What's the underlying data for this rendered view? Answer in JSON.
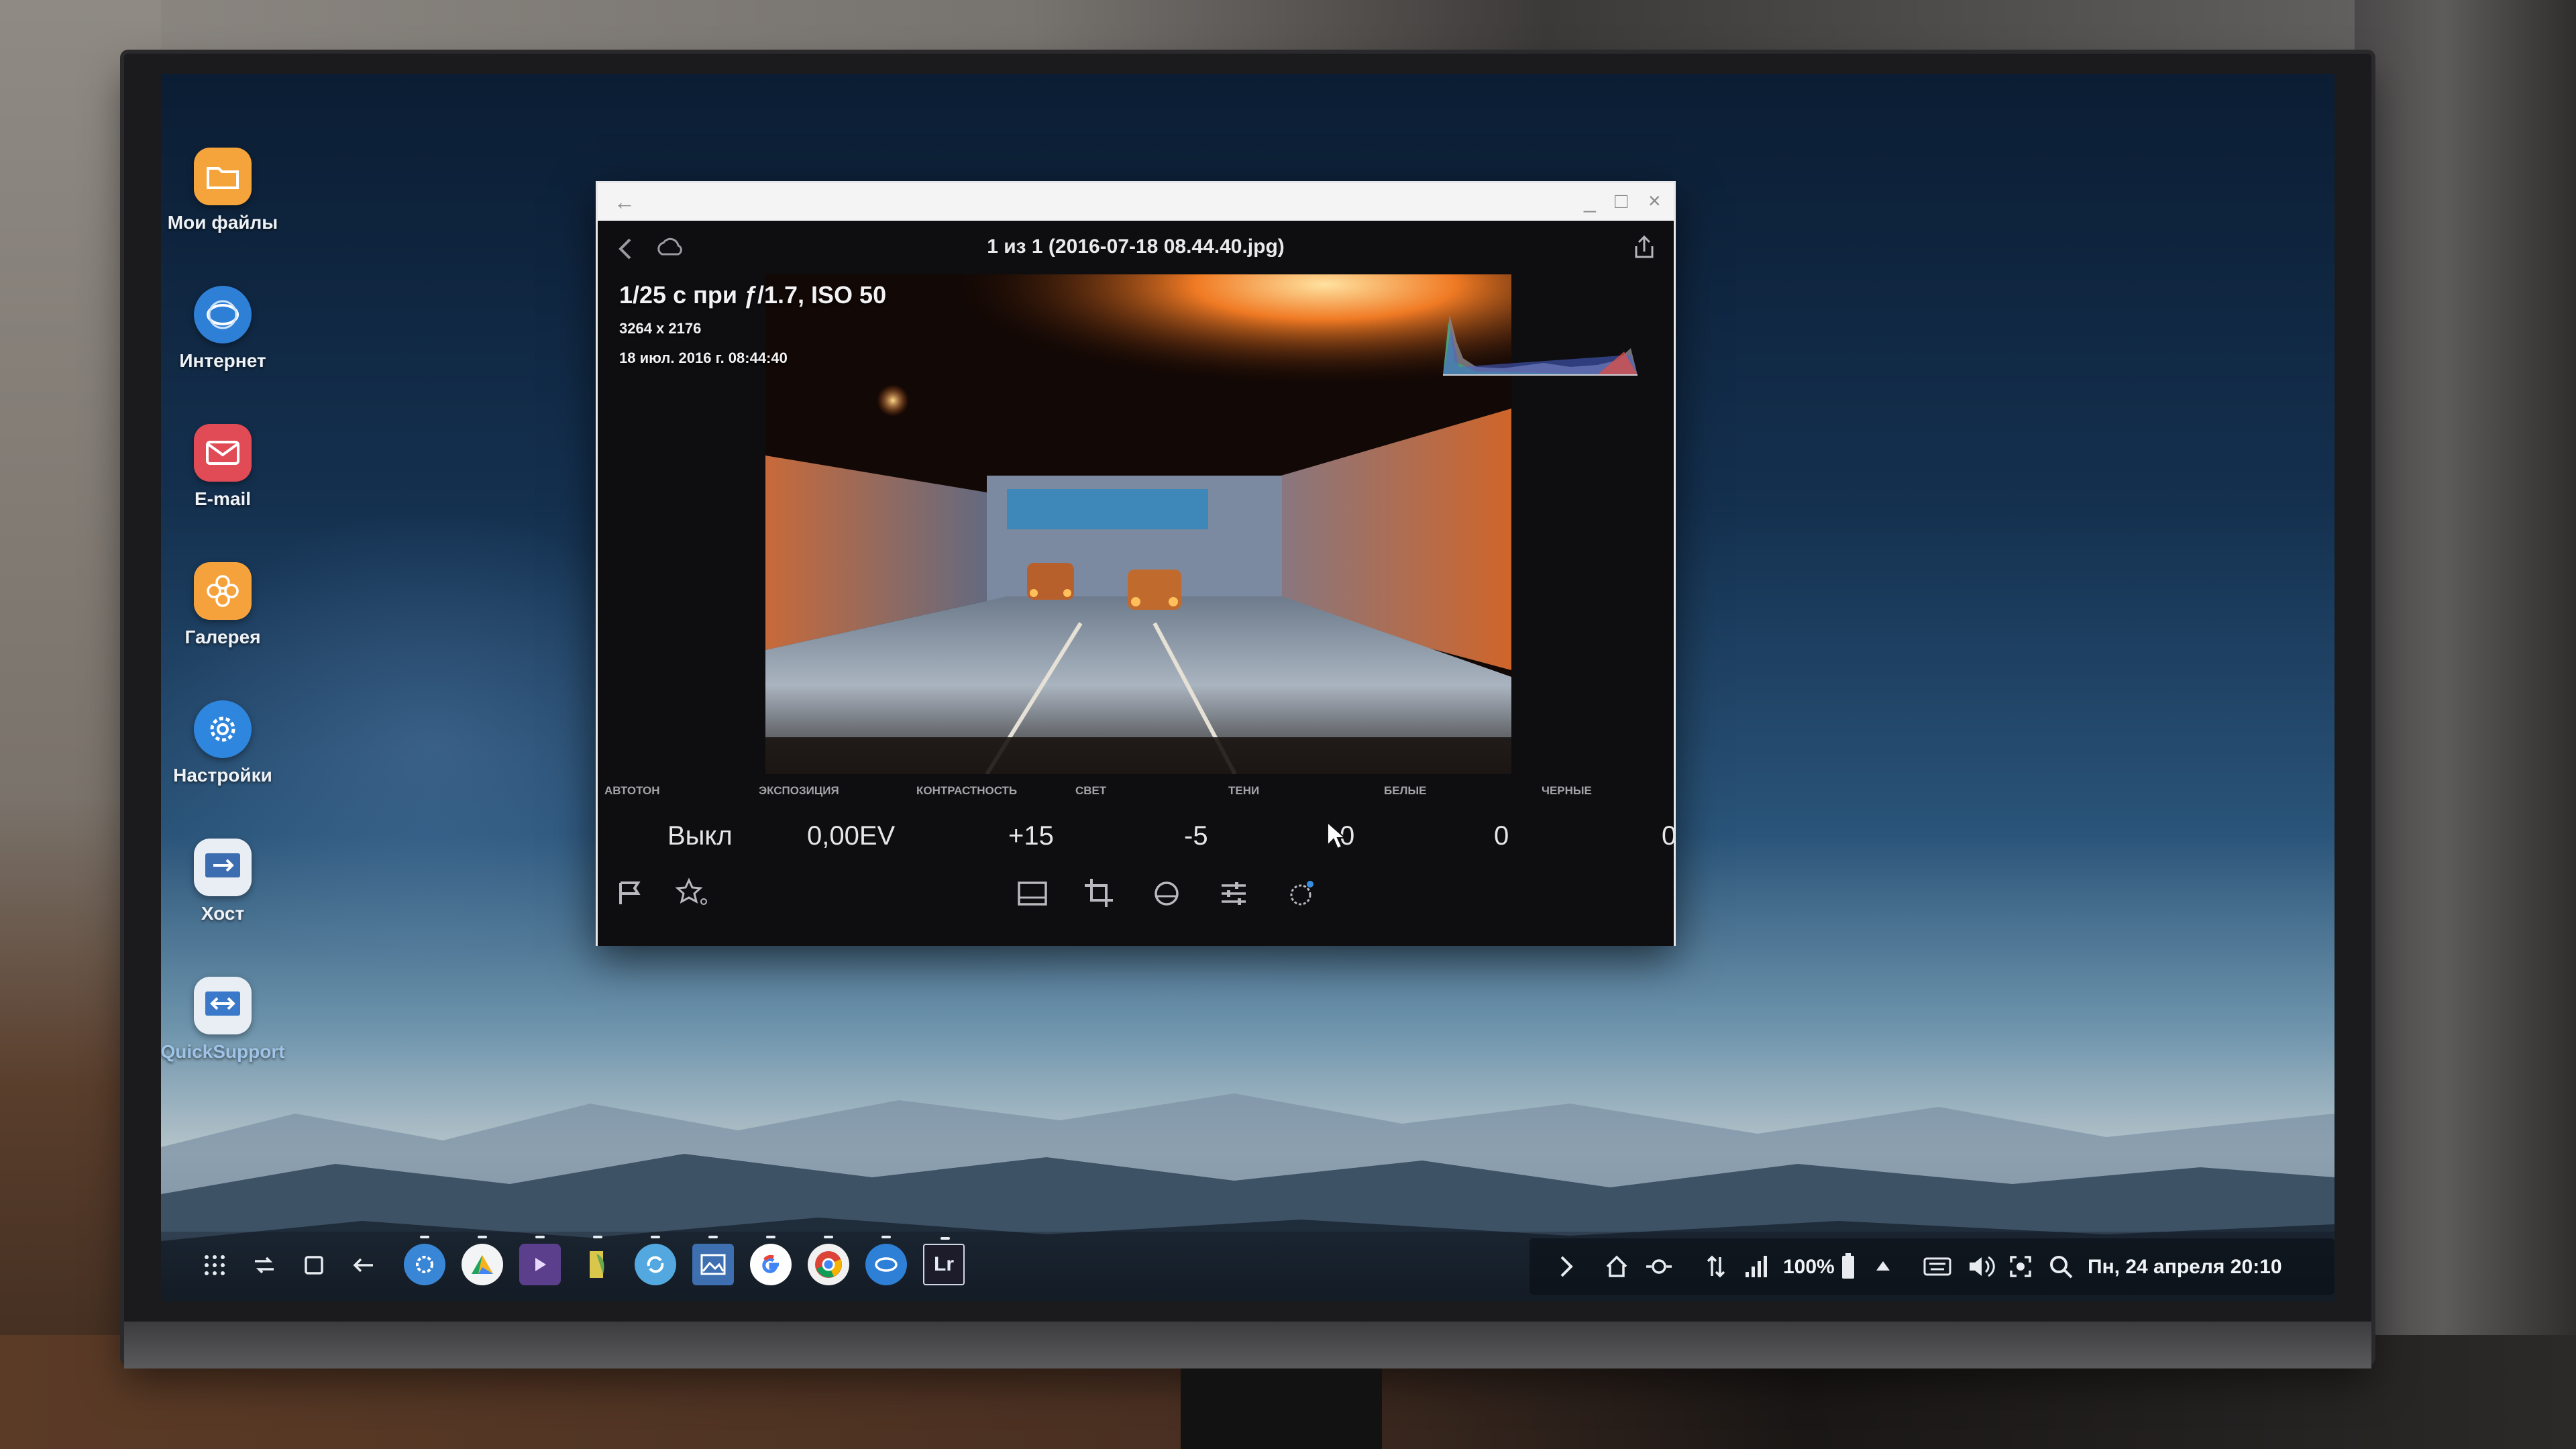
{
  "desktop": {
    "icons": [
      {
        "label": "Мои файлы",
        "icon": "folder-icon",
        "color": "#f4a43a"
      },
      {
        "label": "Интернет",
        "icon": "globe-icon",
        "color": "#2e7fd6"
      },
      {
        "label": "E-mail",
        "icon": "mail-icon",
        "color": "#e14b55"
      },
      {
        "label": "Галерея",
        "icon": "flower-icon",
        "color": "#f5a23c"
      },
      {
        "label": "Настройки",
        "icon": "gear-icon",
        "color": "#2f86de"
      },
      {
        "label": "Хост",
        "icon": "host-icon",
        "color": "#3b6db0"
      },
      {
        "label": "QuickSupport",
        "icon": "quicksupport-icon",
        "color": "#3a79c9"
      }
    ]
  },
  "window": {
    "back_glyph": "←",
    "minimize_glyph": "_",
    "maximize_glyph": "□",
    "close_glyph": "×",
    "title": "1 из 1 (2016-07-18 08.44.40.jpg)",
    "photo": {
      "exposure": "1/25 с при ƒ/1.7, ISO 50",
      "dimensions": "3264 x 2176",
      "date": "18 июл. 2016 г. 08:44:40"
    },
    "adjustments": [
      {
        "label": "Автотон",
        "value": "Выкл"
      },
      {
        "label": "Экспозиция",
        "value": "0,00EV"
      },
      {
        "label": "Контрастность",
        "value": "+15"
      },
      {
        "label": "Свет",
        "value": "-5"
      },
      {
        "label": "Тени",
        "value": "0"
      },
      {
        "label": "Белые",
        "value": "0"
      },
      {
        "label": "Черные",
        "value": "0"
      }
    ],
    "tools": [
      "flag-icon",
      "star-icon",
      "filmstrip-icon",
      "crop-icon",
      "filter-icon",
      "sliders-icon",
      "brush-icon"
    ]
  },
  "taskbar": {
    "system": [
      "apps-grid-icon",
      "recent-apps-icon",
      "home-icon",
      "back-arrow-icon"
    ],
    "apps": [
      {
        "name": "settings-app-icon",
        "color": "#3a86d6"
      },
      {
        "name": "drive-app-icon",
        "color": "#f3f4f6"
      },
      {
        "name": "video-app-icon",
        "color": "#5b3f8d"
      },
      {
        "name": "books-app-icon",
        "color": "#d9c64a"
      },
      {
        "name": "sync-app-icon",
        "color": "#53a9df"
      },
      {
        "name": "gallery-app-icon",
        "color": "#3d6fb1"
      },
      {
        "name": "google-app-icon",
        "color": "#ffffff"
      },
      {
        "name": "chrome-app-icon",
        "color": "#f1f1f1"
      },
      {
        "name": "internet-app-icon",
        "color": "#2e7fd6"
      },
      {
        "name": "lightroom-app-icon",
        "color": "#1c1c2a",
        "text": "Lr"
      }
    ],
    "tray": {
      "battery": "100%",
      "datetime": "Пн, 24 апреля 20:10"
    }
  }
}
